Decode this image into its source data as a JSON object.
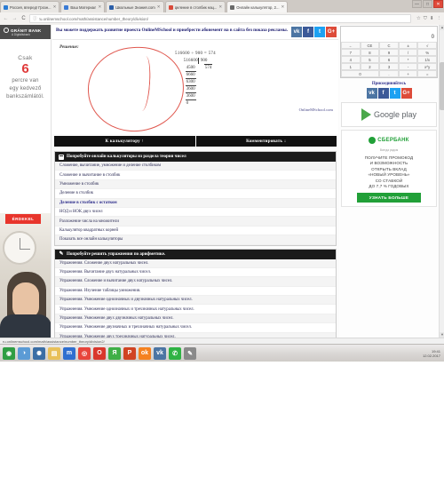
{
  "browser": {
    "tabs": [
      {
        "title": "Россия, вперед! Грозн...",
        "favcolor": "#2b7cd3",
        "active": false
      },
      {
        "title": "Ваш Материал",
        "favcolor": "#3a7bd5",
        "active": false
      },
      {
        "title": "Школьные Знания.com",
        "favcolor": "#2c5fa8",
        "active": false
      },
      {
        "title": "деление в столбик нац...",
        "favcolor": "#d94a3a",
        "active": false
      },
      {
        "title": "Онлайн калькулятор, 2...",
        "favcolor": "#6a6a6a",
        "active": true
      }
    ],
    "window_controls": [
      "—",
      "□",
      "✕"
    ],
    "nav": {
      "back": "←",
      "forward": "→",
      "reload": "C"
    },
    "url": "ru.onlinemschool.com/math/assistance/number_theory/division/",
    "info_icon": "ⓘ",
    "toolbar_icons": [
      "☆",
      "⛉",
      "⬇",
      "⋮"
    ]
  },
  "left_ad": {
    "brand": "GRÁNIT BANK",
    "brand_sub": "A Digitálisbank",
    "line1": "Csak",
    "big_number": "6",
    "line2": "percre van",
    "line3": "egy kedvező",
    "line4": "bankszámlától.",
    "cta": "ÉRDEKEL"
  },
  "promo": {
    "text": "Вы можете поддержать развитие проекта OnlineMSchool и приобрести абонемент на в сайта без показа рекламы.",
    "social": [
      {
        "name": "vk",
        "glyph": "vk",
        "color": "#4c75a3"
      },
      {
        "name": "facebook",
        "glyph": "f",
        "color": "#3b5998"
      },
      {
        "name": "twitter",
        "glyph": "t",
        "color": "#1da1f2"
      },
      {
        "name": "google-plus",
        "glyph": "G+",
        "color": "#dd4b39"
      }
    ]
  },
  "solution": {
    "label": "Решение:",
    "equation": "516600 ÷ 900 = 574",
    "dividend": "516600",
    "divisor": "900",
    "quotient": "574",
    "steps": [
      "4500",
      "6660",
      "6300",
      "3600",
      "3600",
      "0"
    ],
    "credit": "OnlineMSchool.com"
  },
  "buttons": {
    "to_calculator": "К калькулятору ↑",
    "comment": "Комментировать ↓"
  },
  "calculators_panel": {
    "header": "Попробуйте онлайн калькуляторы из раздела теория чисел",
    "items": [
      {
        "label": "Сложение, вычитание, умножение и деление столбиком",
        "current": false
      },
      {
        "label": "Сложение и вычитание в столбик",
        "current": false
      },
      {
        "label": "Умножение в столбик",
        "current": false
      },
      {
        "label": "Деление в столбик",
        "current": false
      },
      {
        "label": "Деление в столбик с остатком",
        "current": true
      },
      {
        "label": "НОД и НОК двух чисел",
        "current": false
      },
      {
        "label": "Разложение числа на множители",
        "current": false
      },
      {
        "label": "Калькулятор квадратных корней",
        "current": false
      },
      {
        "label": "Показать все онлайн калькуляторы",
        "current": false
      }
    ]
  },
  "exercises_panel": {
    "header": "Попробуйте решить упражнения по арифметике.",
    "items": [
      {
        "label": "Упражнения. Сложение двух натуральных чисел."
      },
      {
        "label": "Упражнения. Вычитание двух натуральных чисел."
      },
      {
        "label": "Упражнения. Сложение и вычитание двух натуральных чисел."
      },
      {
        "label": "Упражнения. Изучение таблицы умножения."
      },
      {
        "label": "Упражнения. Умножение однозначных и двузначных натуральных чисел."
      },
      {
        "label": "Упражнения. Умножение однозначных и трехзначных натуральных чисел."
      },
      {
        "label": "Упражнения. Умножение двух двузначных натуральных чисел."
      },
      {
        "label": "Упражнения. Умножение двузначных и трехзначных натуральных чисел."
      },
      {
        "label": "Упражнения. Умножение двух трехзначных натуральных чисел."
      }
    ]
  },
  "calculator_widget": {
    "display": "0",
    "keys": [
      "←",
      "CE",
      "C",
      "±",
      "√",
      "7",
      "8",
      "9",
      "/",
      "%",
      "4",
      "5",
      "6",
      "*",
      "1/x",
      "1",
      "2",
      "3",
      "-",
      "x^y",
      "0",
      ".",
      "+",
      "="
    ]
  },
  "join": {
    "title": "Присоединяйтесь",
    "social": [
      {
        "name": "vk",
        "glyph": "vk",
        "color": "#4c75a3"
      },
      {
        "name": "facebook",
        "glyph": "f",
        "color": "#3b5998"
      },
      {
        "name": "twitter",
        "glyph": "t",
        "color": "#1da1f2"
      },
      {
        "name": "google-plus",
        "glyph": "G+",
        "color": "#dd4b39"
      }
    ]
  },
  "google_play": {
    "label": "Google play"
  },
  "sberbank_ad": {
    "brand": "СБЕРБАНК",
    "brand_sub": "Всегда рядом",
    "line1": "ПОЛУЧИТЕ ПРОМОКОД",
    "line2": "И ВОЗМОЖНОСТЬ",
    "line3": "ОТКРЫТЬ ВКЛАД",
    "line4": "«НОВЫЙ УРОВЕНЬ»",
    "line5": "СО СТАВКОЙ",
    "line6": "ДО 7,7 % ГОДОВЫХ",
    "cta": "УЗНАТЬ БОЛЬШЕ"
  },
  "status_bar": {
    "text": "ru.onlinemschool.com/math/assistance/number_theory/division2/"
  },
  "taskbar": {
    "items": [
      {
        "name": "start-button",
        "glyph": "◉",
        "color": "#2f9e44"
      },
      {
        "name": "volume-icon",
        "glyph": "◑",
        "color": "#5b9bd5"
      },
      {
        "name": "settings-icon",
        "glyph": "✺",
        "color": "#3b6ea5"
      },
      {
        "name": "explorer-icon",
        "glyph": "▤",
        "color": "#e8c05a"
      },
      {
        "name": "maxthon-icon",
        "glyph": "m",
        "color": "#2f6fd0"
      },
      {
        "name": "chrome-icon",
        "glyph": "◎",
        "color": "#e8453c"
      },
      {
        "name": "opera-icon",
        "glyph": "O",
        "color": "#d9372c"
      },
      {
        "name": "yandex-icon",
        "glyph": "Я",
        "color": "#3faf46"
      },
      {
        "name": "powerpoint-icon",
        "glyph": "P",
        "color": "#d04423"
      },
      {
        "name": "odnoklassniki-icon",
        "glyph": "ok",
        "color": "#f58220"
      },
      {
        "name": "vk-icon",
        "glyph": "vk",
        "color": "#4c75a3"
      },
      {
        "name": "whatsapp-icon",
        "glyph": "✆",
        "color": "#2fb344"
      },
      {
        "name": "notes-icon",
        "glyph": "✎",
        "color": "#8a8a8a"
      }
    ],
    "clock_time": "19:41",
    "clock_date": "12.02.2017"
  }
}
